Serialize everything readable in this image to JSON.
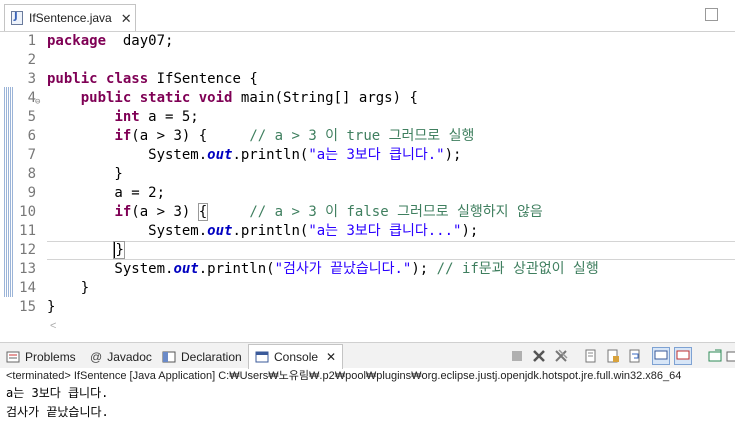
{
  "editor_tab": {
    "filename": "IfSentence.java"
  },
  "code_lines": [
    {
      "n": "1",
      "segments": [
        [
          "kw",
          "package"
        ],
        [
          "",
          "  day07;"
        ]
      ]
    },
    {
      "n": "2",
      "segments": []
    },
    {
      "n": "3",
      "segments": [
        [
          "kw",
          "public"
        ],
        [
          "",
          " "
        ],
        [
          "kw",
          "class"
        ],
        [
          "",
          " IfSentence {"
        ]
      ]
    },
    {
      "n": "4",
      "segments": [
        [
          "",
          "    "
        ],
        [
          "kw",
          "public"
        ],
        [
          "",
          " "
        ],
        [
          "kw",
          "static"
        ],
        [
          "",
          " "
        ],
        [
          "kw",
          "void"
        ],
        [
          "",
          " main(String[] args) {"
        ]
      ]
    },
    {
      "n": "5",
      "segments": [
        [
          "",
          "        "
        ],
        [
          "kw",
          "int"
        ],
        [
          "",
          " a = 5;"
        ]
      ]
    },
    {
      "n": "6",
      "segments": [
        [
          "",
          "        "
        ],
        [
          "kw",
          "if"
        ],
        [
          "",
          "(a > 3) {     "
        ],
        [
          "cm",
          "// a > 3 이 true 그러므로 실행"
        ]
      ]
    },
    {
      "n": "7",
      "segments": [
        [
          "",
          "            System."
        ],
        [
          "fld",
          "out"
        ],
        [
          "",
          ".println("
        ],
        [
          "st",
          "\"a는 3보다 큽니다.\""
        ],
        [
          "",
          ");"
        ]
      ]
    },
    {
      "n": "8",
      "segments": [
        [
          "",
          "        }"
        ]
      ]
    },
    {
      "n": "9",
      "segments": [
        [
          "",
          "        a = 2;"
        ]
      ]
    },
    {
      "n": "10",
      "segments": [
        [
          "",
          "        "
        ],
        [
          "kw",
          "if"
        ],
        [
          "",
          "(a > 3) "
        ],
        [
          "brk",
          "{"
        ],
        [
          "",
          "     "
        ],
        [
          "cm",
          "// a > 3 이 false 그러므로 실행하지 않음"
        ]
      ]
    },
    {
      "n": "11",
      "segments": [
        [
          "",
          "            System."
        ],
        [
          "fld",
          "out"
        ],
        [
          "",
          ".println("
        ],
        [
          "st",
          "\"a는 3보다 큽니다...\""
        ],
        [
          "",
          ");"
        ]
      ]
    },
    {
      "n": "12",
      "segments": [
        [
          "",
          "        "
        ],
        [
          "brk",
          "}"
        ]
      ]
    },
    {
      "n": "13",
      "segments": [
        [
          "",
          "        System."
        ],
        [
          "fld",
          "out"
        ],
        [
          "",
          ".println("
        ],
        [
          "st",
          "\"검사가 끝났습니다.\""
        ],
        [
          "",
          "); "
        ],
        [
          "cm",
          "// if문과 상관없이 실행"
        ]
      ]
    },
    {
      "n": "14",
      "segments": [
        [
          "",
          "    }"
        ]
      ]
    },
    {
      "n": "15",
      "segments": [
        [
          "",
          "}"
        ]
      ]
    }
  ],
  "panel_tabs": {
    "problems": "Problems",
    "javadoc": "Javadoc",
    "declaration": "Declaration",
    "console": "Console"
  },
  "console": {
    "header": "<terminated> IfSentence [Java Application] C:₩Users₩노유림₩.p2₩pool₩plugins₩org.eclipse.justj.openjdk.hotspot.jre.full.win32.x86_64",
    "output": [
      "a는 3보다 큽니다.",
      "검사가 끝났습니다."
    ]
  }
}
